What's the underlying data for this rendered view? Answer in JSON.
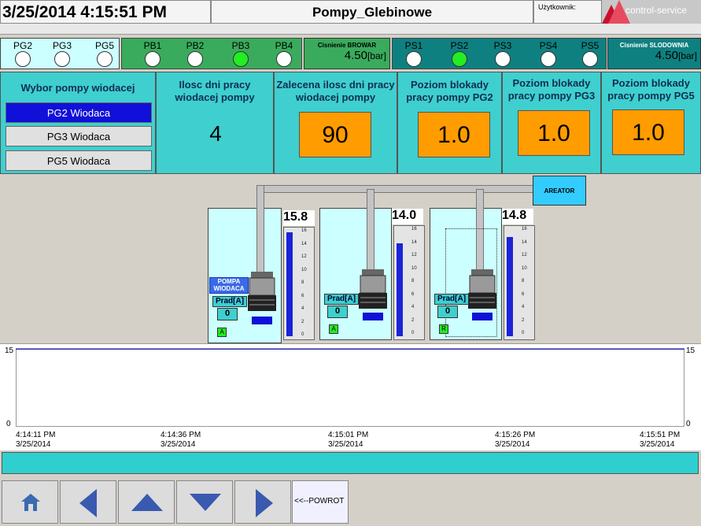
{
  "header": {
    "datetime": "3/25/2014 4:15:51 PM",
    "screen_title": "Pompy_Glebinowe",
    "user_label": "Użytkownik:",
    "logo": "control-service"
  },
  "status": {
    "pg": [
      {
        "label": "PG2",
        "on": false
      },
      {
        "label": "PG3",
        "on": false
      },
      {
        "label": "PG5",
        "on": false
      }
    ],
    "pb": [
      {
        "label": "PB1",
        "on": false
      },
      {
        "label": "PB2",
        "on": false
      },
      {
        "label": "PB3",
        "on": true
      },
      {
        "label": "PB4",
        "on": false
      }
    ],
    "browar": {
      "title": "Cisnienie BROWAR",
      "value": "4.50",
      "unit": "[bar]"
    },
    "ps": [
      {
        "label": "PS1",
        "on": false
      },
      {
        "label": "PS2",
        "on": true
      },
      {
        "label": "PS3",
        "on": false
      },
      {
        "label": "PS4",
        "on": false
      },
      {
        "label": "PS5",
        "on": false
      }
    ],
    "slodownia": {
      "title": "Cisnienie SLODOWNIA",
      "value": "4.50",
      "unit": "[bar]"
    }
  },
  "panels": {
    "selection": {
      "title": "Wybor pompy wiodacej",
      "options": [
        "PG2 Wiodaca",
        "PG3 Wiodaca",
        "PG5 Wiodaca"
      ],
      "selected_index": 0
    },
    "days": {
      "title": "Ilosc dni pracy wiodacej pompy",
      "value": "4"
    },
    "recommended": {
      "title": "Zalecena ilosc dni pracy wiodacej pompy",
      "value": "90"
    },
    "block_pg2": {
      "title": "Poziom blokady pracy pompy PG2",
      "value": "1.0"
    },
    "block_pg3": {
      "title": "Poziom blokady pracy pompy PG3",
      "value": "1.0"
    },
    "block_pg5": {
      "title": "Poziom blokady pracy pompy PG5",
      "value": "1.0"
    }
  },
  "process": {
    "areator_label": "AREATOR",
    "scale_ticks": [
      "16",
      "14",
      "12",
      "10",
      "8",
      "6",
      "4",
      "2",
      "0"
    ],
    "wells": [
      {
        "level": "15.8",
        "level_value": 15.8,
        "leading_label": "POMPA WIODACA",
        "prad_label": "Prad[A]",
        "prad_value": "0",
        "mode": "A"
      },
      {
        "level": "14.0",
        "level_value": 14.0,
        "leading_label": "",
        "prad_label": "Prad[A]",
        "prad_value": "0",
        "mode": "A"
      },
      {
        "level": "14.8",
        "level_value": 14.8,
        "leading_label": "",
        "prad_label": "Prad[A]",
        "prad_value": "0",
        "mode": "R"
      }
    ]
  },
  "trend": {
    "y_max": "15",
    "y_min": "0",
    "x_labels": [
      {
        "time": "4:14:11 PM",
        "date": "3/25/2014"
      },
      {
        "time": "4:14:36 PM",
        "date": "3/25/2014"
      },
      {
        "time": "4:15:01 PM",
        "date": "3/25/2014"
      },
      {
        "time": "4:15:26 PM",
        "date": "3/25/2014"
      },
      {
        "time": "4:15:51 PM",
        "date": "3/25/2014"
      }
    ]
  },
  "nav": {
    "back_label": "<<--POWROT"
  },
  "colors": {
    "panel_bg": "#3fcfcf",
    "orange": "#ff9c00",
    "lamp_on": "#22ee22",
    "selected_blue": "#1010d8"
  }
}
